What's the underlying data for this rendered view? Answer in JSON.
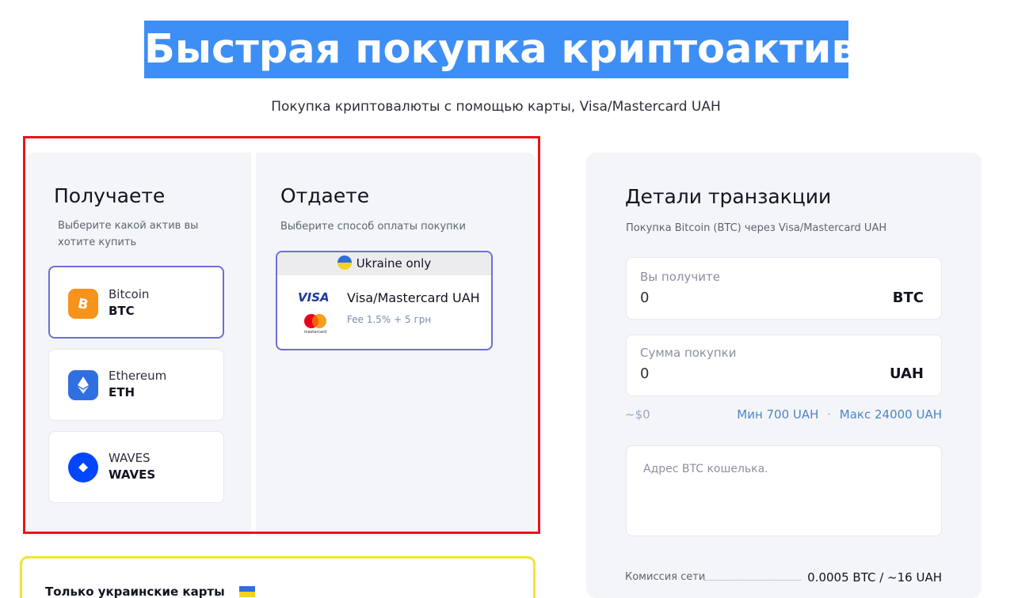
{
  "hero": {
    "title": "Быстрая покупка криптоактивов",
    "subtitle": "Покупка криптовалюты с помощью карты, Visa/Mastercard UAH"
  },
  "receive": {
    "title": "Получаете",
    "hint_line1": "Выберите какой актив вы",
    "hint_line2": "хотите купить",
    "assets": [
      {
        "name": "Bitcoin",
        "ticker": "BTC",
        "icon": "bitcoin-icon",
        "color": "#f7931a",
        "selected": true
      },
      {
        "name": "Ethereum",
        "ticker": "ETH",
        "icon": "ethereum-icon",
        "color": "#2f6fe0",
        "selected": false
      },
      {
        "name": "WAVES",
        "ticker": "WAVES",
        "icon": "waves-icon",
        "color": "#0046ff",
        "selected": false
      }
    ]
  },
  "give": {
    "title": "Отдаете",
    "hint": "Выберите способ оплаты покупки",
    "method": {
      "banner": "Ukraine only",
      "name": "Visa/Mastercard UAH",
      "fee": "Fee 1.5% + 5 грн",
      "visa_logo": "VISA",
      "mastercard_logo": "mastercard"
    }
  },
  "details": {
    "title": "Детали транзакции",
    "subtitle": "Покупка Bitcoin (BTC) через Visa/Mastercard UAH",
    "receive_field": {
      "label": "Вы получите",
      "value": "0",
      "unit": "BTC"
    },
    "amount_field": {
      "label": "Сумма покупки",
      "value": "0",
      "unit": "UAH"
    },
    "usd_estimate": "~$0",
    "min_limit": "Мин 700 UAH",
    "separator": "·",
    "max_limit": "Макс 24000 UAH",
    "wallet_placeholder": "Адрес BTC кошелька.",
    "fee_label": "Комиссия сети",
    "fee_value": "0.0005 BTC / ~16 UAH"
  },
  "notice": {
    "title": "Только украинские карты"
  },
  "colors": {
    "accent": "#3d8ff5",
    "selection": "#6c6fd6",
    "highlight_red": "#e8141c",
    "highlight_yellow": "#f2e33a",
    "link_blue": "#4a86c8",
    "flag_blue": "#2f6fd6",
    "flag_yellow": "#f7d21c"
  }
}
